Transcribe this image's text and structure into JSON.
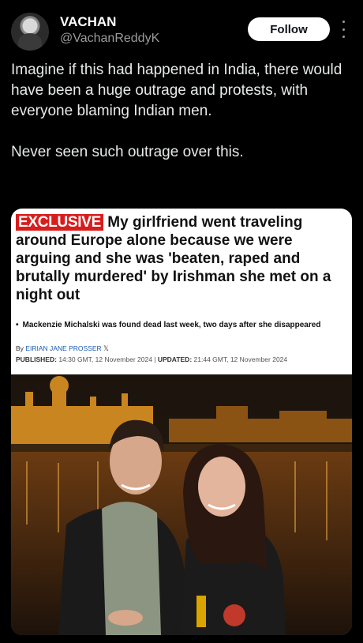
{
  "user": {
    "display_name": "VACHAN",
    "handle": "@VachanReddyK",
    "follow_label": "Follow"
  },
  "tweet": {
    "paragraph_1": "Imagine if this had happened in India, there would have been a huge outrage and protests, with everyone blaming Indian men.",
    "paragraph_2": "Never seen such outrage over this."
  },
  "article": {
    "badge": "EXCLUSIVE",
    "headline": "My girlfriend went traveling around Europe alone because we were arguing and she was 'beaten, raped and brutally murdered' by Irishman she met on a night out",
    "bullet": "Mackenzie Michalski was found dead last week, two days after she disappeared",
    "byline_prefix": "By",
    "author": "EIRIAN JANE PROSSER",
    "published_label": "PUBLISHED:",
    "published": "14:30 GMT, 12 November 2024",
    "updated_label": "UPDATED:",
    "updated": "21:44 GMT, 12 November 2024"
  },
  "colors": {
    "background": "#000000",
    "exclusive_badge": "#d81d1d",
    "author_link": "#1a5bb3"
  }
}
